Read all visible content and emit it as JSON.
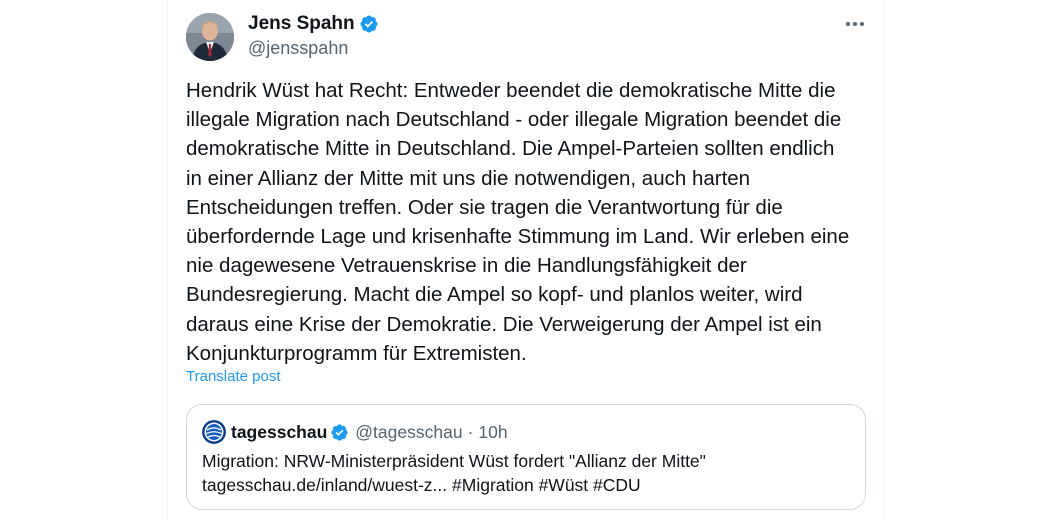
{
  "tweet": {
    "author_name": "Jens Spahn",
    "author_handle": "@jensspahn",
    "verified_icon": "verified-badge-icon",
    "more_icon": "more-options-icon",
    "text": "Hendrik Wüst hat Recht: Entweder beendet die demokratische Mitte die\nillegale Migration nach Deutschland - oder illegale Migration beendet die\ndemokratische Mitte in Deutschland. Die Ampel-Parteien sollten endlich\nin einer Allianz der Mitte mit uns die notwendigen, auch harten\nEntscheidungen treffen. Oder sie tragen die Verantwortung für die\nüberfordernde Lage und krisenhafte Stimmung im Land. Wir erleben eine\nnie dagewesene Vetrauenskrise in die Handlungsfähigkeit der\nBundesregierung. Macht die Ampel so kopf- und planlos weiter, wird\ndaraus eine Krise der Demokratie. Die Verweigerung der Ampel ist ein\nKonjunkturprogramm für Extremisten.",
    "translate_label": "Translate post"
  },
  "quote": {
    "author_name": "tagesschau",
    "author_handle": "@tagesschau",
    "separator": "·",
    "time": "10h",
    "text_line1": "Migration: NRW-Ministerpräsident Wüst fordert \"Allianz der Mitte\"",
    "text_line2": "tagesschau.de/inland/wuest-z... #Migration #Wüst #CDU"
  },
  "colors": {
    "accent": "#1d9bf0",
    "text_primary": "#0f1419",
    "text_secondary": "#536471",
    "border": "#cfd9de"
  }
}
